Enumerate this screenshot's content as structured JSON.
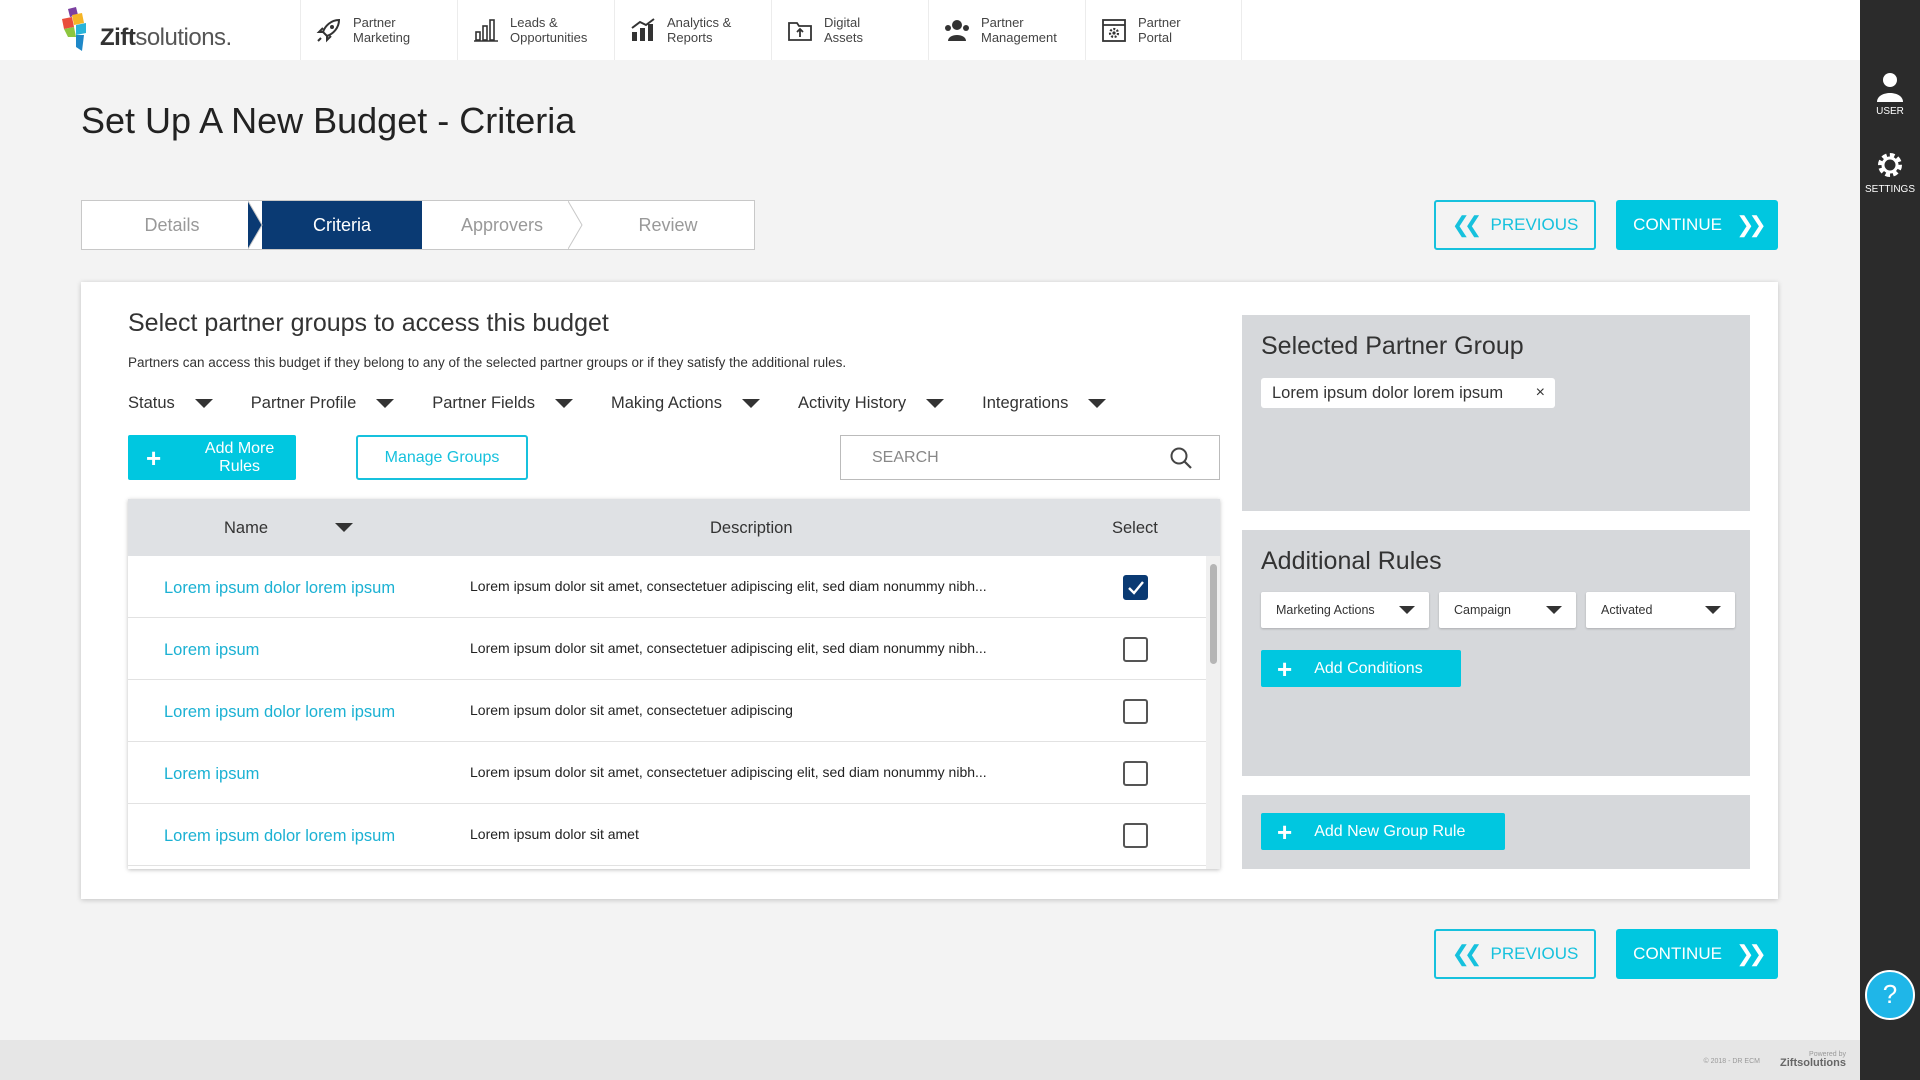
{
  "brand": {
    "name_bold": "Zift",
    "name_light": "solutions",
    "suffix": "."
  },
  "nav": [
    {
      "label": "Partner\nMarketing",
      "icon": "rocket-icon"
    },
    {
      "label": "Leads &\nOpportunities",
      "icon": "bar-chart-icon"
    },
    {
      "label": "Analytics &\nReports",
      "icon": "analytics-icon"
    },
    {
      "label": "Digital\nAssets",
      "icon": "folder-icon"
    },
    {
      "label": "Partner\nManagement",
      "icon": "people-icon"
    },
    {
      "label": "Partner\nPortal",
      "icon": "portal-icon"
    }
  ],
  "rail": {
    "user_label": "USER",
    "settings_label": "SETTINGS",
    "help_label": "?"
  },
  "page": {
    "title": "Set Up A New Budget - Criteria"
  },
  "steps": [
    "Details",
    "Criteria",
    "Approvers",
    "Review"
  ],
  "active_step": "Criteria",
  "buttons": {
    "previous": "PREVIOUS",
    "continue": "CONTINUE"
  },
  "section": {
    "title": "Select partner groups to access this budget",
    "description": "Partners can access this budget if they belong to any of the selected partner groups or if they satisfy the additional rules."
  },
  "filters": [
    "Status",
    "Partner Profile",
    "Partner Fields",
    "Making Actions",
    "Activity History",
    "Integrations"
  ],
  "actions": {
    "add_more_rules": "Add More Rules",
    "manage_groups": "Manage Groups"
  },
  "search": {
    "placeholder": "SEARCH"
  },
  "table": {
    "columns": [
      "Name",
      "Description",
      "Select"
    ],
    "rows": [
      {
        "name": "Lorem ipsum dolor lorem ipsum",
        "description": "Lorem ipsum dolor sit amet, consectetuer adipiscing elit, sed diam nonummy nibh...",
        "selected": true
      },
      {
        "name": "Lorem ipsum",
        "description": "Lorem ipsum dolor sit amet, consectetuer adipiscing elit, sed diam nonummy nibh...",
        "selected": false
      },
      {
        "name": "Lorem ipsum dolor lorem ipsum",
        "description": "Lorem ipsum dolor sit amet, consectetuer adipiscing",
        "selected": false
      },
      {
        "name": "Lorem ipsum",
        "description": "Lorem ipsum dolor sit amet, consectetuer adipiscing elit, sed diam nonummy nibh...",
        "selected": false
      },
      {
        "name": "Lorem ipsum dolor lorem ipsum",
        "description": "Lorem ipsum dolor sit amet",
        "selected": false
      }
    ]
  },
  "selected_group": {
    "title": "Selected Partner Group",
    "chip": "Lorem ipsum dolor lorem ipsum",
    "chip_remove": "×"
  },
  "additional_rules": {
    "title": "Additional Rules",
    "dropdowns": [
      "Marketing Actions",
      "Campaign",
      "Activated"
    ],
    "add_conditions": "Add Conditions"
  },
  "add_group_rule": "Add New Group Rule",
  "footer": {
    "copyright": "© 2018 - DR ECM",
    "powered_by": "Powered by",
    "powered_brand": "Ziftsolutions"
  },
  "colors": {
    "accent": "#00c7e0",
    "navy": "#0a3a73",
    "link": "#1bb1d3",
    "rail": "#2b2b2b"
  }
}
